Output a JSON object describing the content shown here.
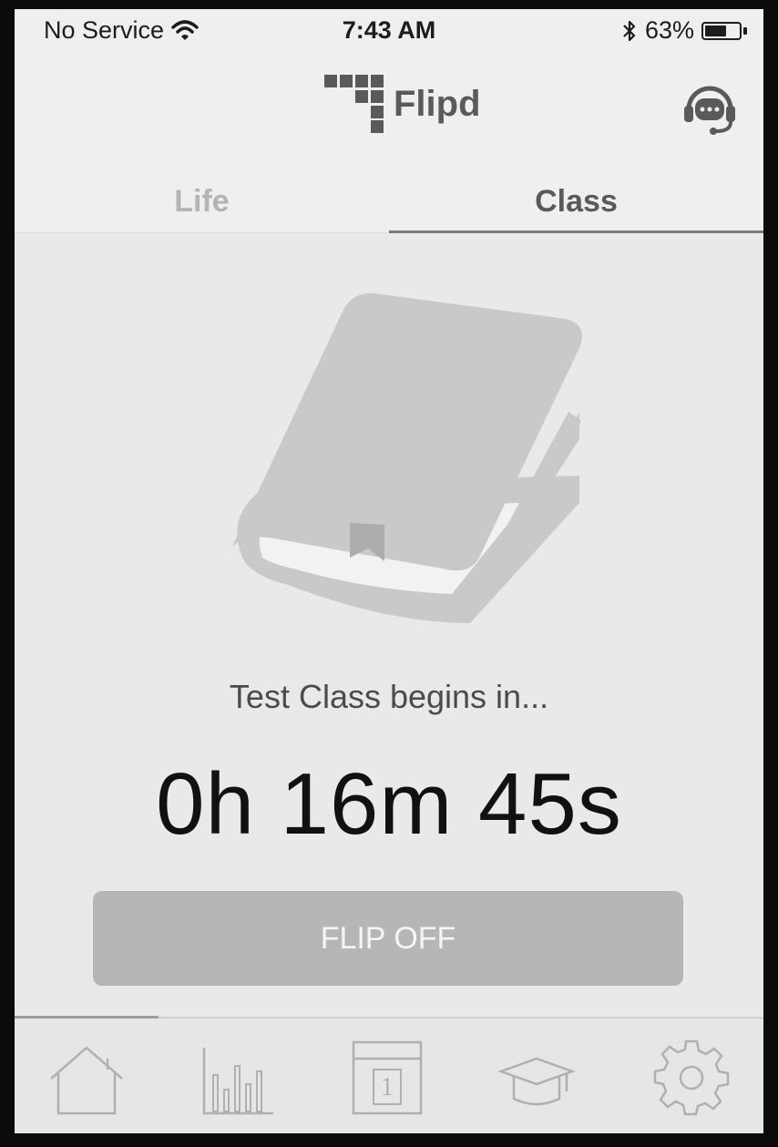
{
  "status_bar": {
    "carrier": "No Service",
    "time": "7:43 AM",
    "battery_percent": "63%",
    "battery_level": 0.63,
    "wifi_icon": "wifi-icon",
    "bluetooth_icon": "bluetooth-icon"
  },
  "header": {
    "app_name": "Flipd",
    "logo_icon": "flipd-logo-icon",
    "support_icon": "headset-chat-icon"
  },
  "tabs": [
    {
      "label": "Life",
      "active": false
    },
    {
      "label": "Class",
      "active": true
    }
  ],
  "main": {
    "illustration_icon": "book-icon",
    "subtitle": "Test Class begins in...",
    "countdown": "0h 16m 45s",
    "button_label": "FLIP OFF"
  },
  "bottom_nav": {
    "items": [
      {
        "icon": "home-icon",
        "active": true
      },
      {
        "icon": "bar-chart-icon",
        "active": false
      },
      {
        "icon": "calendar-icon",
        "label": "1",
        "active": false
      },
      {
        "icon": "graduation-cap-icon",
        "active": false
      },
      {
        "icon": "gear-icon",
        "active": false
      }
    ]
  },
  "colors": {
    "background": "#efefed",
    "content": "#e9e9e7",
    "button": "#b6b6b4",
    "accent": "#7a7a7a",
    "text_dark": "#111111"
  }
}
